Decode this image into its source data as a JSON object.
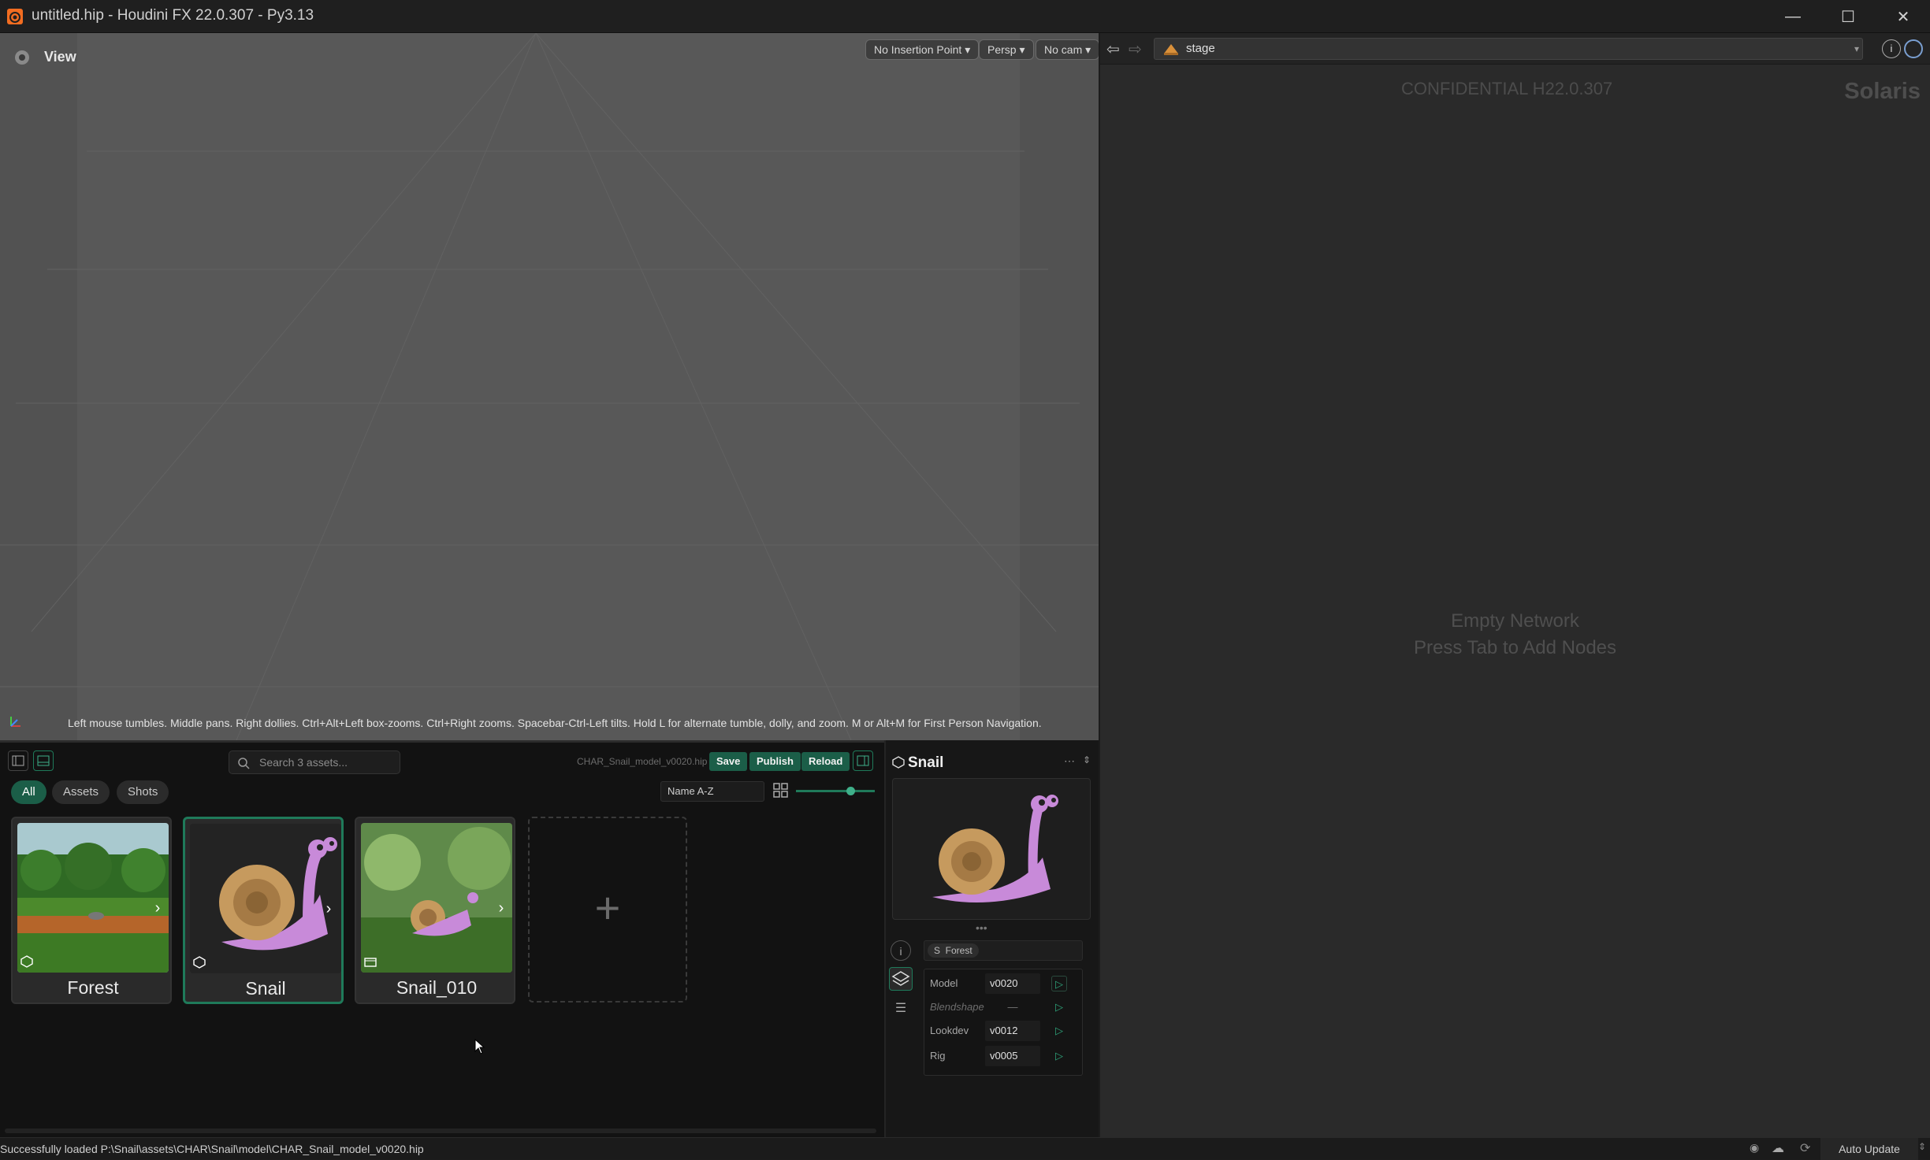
{
  "window": {
    "title": "untitled.hip - Houdini FX 22.0.307 - Py3.13"
  },
  "viewport": {
    "title": "View",
    "insertion_point": "No Insertion Point",
    "projection": "Persp",
    "camera": "No cam",
    "hint": "Left mouse tumbles. Middle pans. Right dollies. Ctrl+Alt+Left box-zooms. Ctrl+Right zooms. Spacebar-Ctrl-Left tilts. Hold L for alternate tumble, dolly, and zoom. M or Alt+M for First Person Navigation."
  },
  "network": {
    "path": "stage",
    "watermark": "CONFIDENTIAL H22.0.307",
    "context_label": "Solaris",
    "empty_line1": "Empty Network",
    "empty_line2": "Press Tab to Add Nodes"
  },
  "browser": {
    "search_placeholder": "Search 3 assets...",
    "file_name": "CHAR_Snail_model_v0020.hip",
    "save_label": "Save",
    "publish_label": "Publish",
    "reload_label": "Reload",
    "filters": [
      "All",
      "Assets",
      "Shots"
    ],
    "sort": "Name A-Z",
    "cards": [
      {
        "label": "Forest"
      },
      {
        "label": "Snail"
      },
      {
        "label": "Snail_010"
      }
    ]
  },
  "detail": {
    "title": "Snail",
    "scene_tag": "S  Forest",
    "rows": [
      {
        "name": "Model",
        "value": "v0020"
      },
      {
        "name": "Blendshape",
        "value": "—"
      },
      {
        "name": "Lookdev",
        "value": "v0012"
      },
      {
        "name": "Rig",
        "value": "v0005"
      }
    ]
  },
  "status": {
    "message": "Successfully loaded P:\\Snail\\assets\\CHAR\\Snail\\model\\CHAR_Snail_model_v0020.hip",
    "auto_update": "Auto Update"
  },
  "colors": {
    "accent_green": "#1b5e48",
    "selected_border": "#1f7a5a",
    "viewport_bg": "#585858"
  }
}
